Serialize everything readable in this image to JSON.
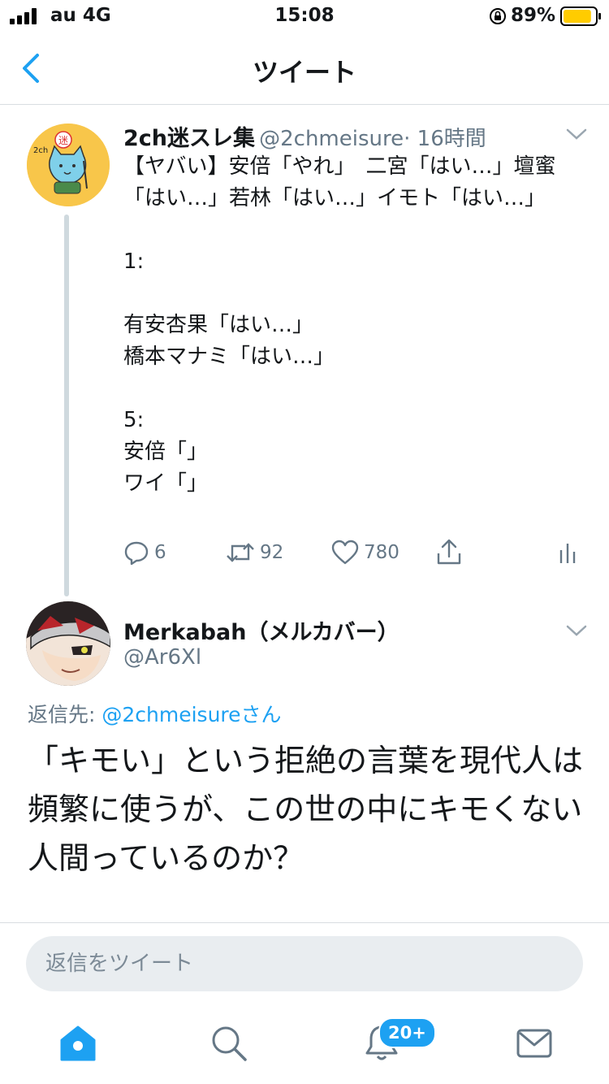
{
  "status_bar": {
    "carrier": "au 4G",
    "time": "15:08",
    "battery": "89%",
    "battery_level": 0.89
  },
  "nav": {
    "title": "ツイート"
  },
  "tweet1": {
    "name": "2ch迷スレ集",
    "handle": "@2chmeisure",
    "time": "· 16時間",
    "avatar_text": "2ch迷スレ集",
    "body": "【ヤバい】安倍「やれ」　二宮「はい…」壇蜜「はい…」若林「はい…」イモト「はい…」\n\n1:\n\n有安杏果「はい…」\n橋本マナミ「はい…」\n\n5:\n安倍「」\nワイ「」",
    "replies": "6",
    "retweets": "92",
    "likes": "780"
  },
  "tweet2": {
    "name": "Merkabah（メルカバー）",
    "handle": "@Ar6Xl",
    "reply_to_prefix": "返信先: ",
    "reply_to_user": "@2chmeisureさん",
    "body": "「キモい」という拒絶の言葉を現代人は頻繁に使うが、この世の中にキモくない人間っているのか？"
  },
  "reply": {
    "placeholder": "返信をツイート"
  },
  "tabbar": {
    "notifications_badge": "20+"
  },
  "colors": {
    "accent": "#1da1f2",
    "secondary_text": "#657786",
    "battery": "#ffcc00"
  }
}
